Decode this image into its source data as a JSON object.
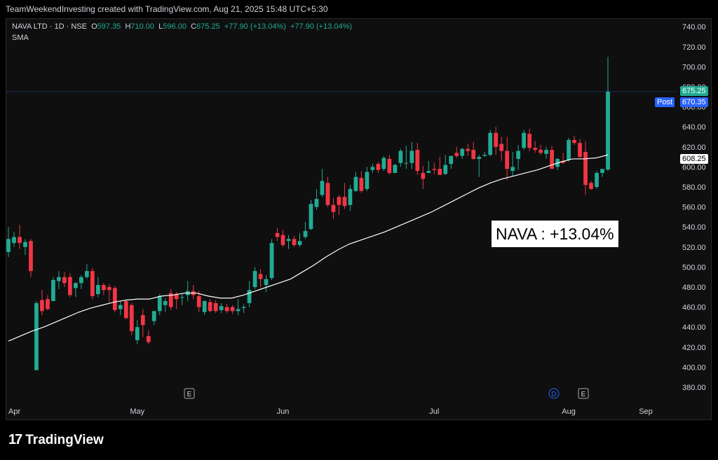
{
  "header": {
    "attribution": "TeamWeekendInvesting created with TradingView.com, Aug 21, 2025 15:48 UTC+5:30"
  },
  "legend": {
    "symbol": "NAVA LTD · 1D · NSE",
    "o_label": "O",
    "o_value": "597.35",
    "h_label": "H",
    "h_value": "710.00",
    "l_label": "L",
    "l_value": "596.00",
    "c_label": "C",
    "c_value": "675.25",
    "change1": "+77.90 (+13.04%)",
    "change2": "+77.90 (+13.04%)",
    "indicator": "SMA"
  },
  "annotation": "NAVA : +13.04%",
  "price_tags": {
    "last": "675.25",
    "post_label": "Post",
    "post": "670.35",
    "sma": "608.25"
  },
  "footer": {
    "brand": "TradingView",
    "logo_mark": "17"
  },
  "colors": {
    "up": "#22ab94",
    "down": "#f23645",
    "sma": "#ffffff",
    "post": "#2962ff",
    "background": "#0f0f0f"
  },
  "chart_data": {
    "type": "candlestick",
    "ylim": [
      370,
      745
    ],
    "yticks": [
      380,
      400,
      420,
      440,
      460,
      480,
      500,
      520,
      540,
      560,
      580,
      600,
      620,
      640,
      660,
      680,
      700,
      720,
      740
    ],
    "x_month_labels": [
      "Apr",
      "May",
      "Jun",
      "Jul",
      "Aug",
      "Sep"
    ],
    "event_markers": [
      "E",
      "D",
      "E"
    ],
    "ohlc": [
      {
        "o": 515,
        "h": 540,
        "l": 510,
        "c": 528
      },
      {
        "o": 524,
        "h": 535,
        "l": 520,
        "c": 530
      },
      {
        "o": 530,
        "h": 542,
        "l": 518,
        "c": 524
      },
      {
        "o": 520,
        "h": 528,
        "l": 512,
        "c": 525
      },
      {
        "o": 526,
        "h": 528,
        "l": 490,
        "c": 496
      },
      {
        "o": 397,
        "h": 466,
        "l": 397,
        "c": 464
      },
      {
        "o": 467,
        "h": 477,
        "l": 452,
        "c": 456
      },
      {
        "o": 468,
        "h": 472,
        "l": 457,
        "c": 458
      },
      {
        "o": 466,
        "h": 490,
        "l": 466,
        "c": 487
      },
      {
        "o": 486,
        "h": 496,
        "l": 478,
        "c": 490
      },
      {
        "o": 490,
        "h": 495,
        "l": 480,
        "c": 484
      },
      {
        "o": 490,
        "h": 494,
        "l": 470,
        "c": 472
      },
      {
        "o": 479,
        "h": 485,
        "l": 470,
        "c": 484
      },
      {
        "o": 484,
        "h": 492,
        "l": 478,
        "c": 490
      },
      {
        "o": 490,
        "h": 503,
        "l": 488,
        "c": 496
      },
      {
        "o": 496,
        "h": 499,
        "l": 468,
        "c": 471
      },
      {
        "o": 473,
        "h": 490,
        "l": 470,
        "c": 482
      },
      {
        "o": 482,
        "h": 484,
        "l": 472,
        "c": 477
      },
      {
        "o": 480,
        "h": 483,
        "l": 465,
        "c": 477
      },
      {
        "o": 479,
        "h": 481,
        "l": 455,
        "c": 457
      },
      {
        "o": 458,
        "h": 466,
        "l": 452,
        "c": 462
      },
      {
        "o": 466,
        "h": 467,
        "l": 448,
        "c": 449
      },
      {
        "o": 462,
        "h": 464,
        "l": 432,
        "c": 436
      },
      {
        "o": 427,
        "h": 447,
        "l": 423,
        "c": 440
      },
      {
        "o": 452,
        "h": 458,
        "l": 430,
        "c": 442
      },
      {
        "o": 431,
        "h": 437,
        "l": 423,
        "c": 425
      },
      {
        "o": 446,
        "h": 456,
        "l": 442,
        "c": 456
      },
      {
        "o": 456,
        "h": 473,
        "l": 452,
        "c": 471
      },
      {
        "o": 462,
        "h": 469,
        "l": 455,
        "c": 466
      },
      {
        "o": 474,
        "h": 478,
        "l": 457,
        "c": 460
      },
      {
        "o": 473,
        "h": 475,
        "l": 458,
        "c": 468
      },
      {
        "o": 470,
        "h": 474,
        "l": 462,
        "c": 470
      },
      {
        "o": 472,
        "h": 486,
        "l": 466,
        "c": 476
      },
      {
        "o": 476,
        "h": 482,
        "l": 468,
        "c": 472
      },
      {
        "o": 471,
        "h": 476,
        "l": 455,
        "c": 460
      },
      {
        "o": 455,
        "h": 467,
        "l": 452,
        "c": 466
      },
      {
        "o": 465,
        "h": 468,
        "l": 455,
        "c": 456
      },
      {
        "o": 464,
        "h": 467,
        "l": 454,
        "c": 456
      },
      {
        "o": 457,
        "h": 464,
        "l": 454,
        "c": 461
      },
      {
        "o": 460,
        "h": 463,
        "l": 454,
        "c": 456
      },
      {
        "o": 460,
        "h": 462,
        "l": 453,
        "c": 456
      },
      {
        "o": 456,
        "h": 468,
        "l": 452,
        "c": 458
      },
      {
        "o": 459,
        "h": 463,
        "l": 454,
        "c": 460
      },
      {
        "o": 464,
        "h": 486,
        "l": 460,
        "c": 477
      },
      {
        "o": 480,
        "h": 500,
        "l": 478,
        "c": 496
      },
      {
        "o": 493,
        "h": 498,
        "l": 480,
        "c": 488
      },
      {
        "o": 482,
        "h": 492,
        "l": 475,
        "c": 488
      },
      {
        "o": 489,
        "h": 528,
        "l": 487,
        "c": 524
      },
      {
        "o": 534,
        "h": 539,
        "l": 526,
        "c": 530
      },
      {
        "o": 532,
        "h": 537,
        "l": 520,
        "c": 522
      },
      {
        "o": 526,
        "h": 532,
        "l": 518,
        "c": 528
      },
      {
        "o": 528,
        "h": 531,
        "l": 520,
        "c": 522
      },
      {
        "o": 522,
        "h": 534,
        "l": 520,
        "c": 526
      },
      {
        "o": 530,
        "h": 545,
        "l": 528,
        "c": 536
      },
      {
        "o": 538,
        "h": 567,
        "l": 537,
        "c": 563
      },
      {
        "o": 560,
        "h": 578,
        "l": 557,
        "c": 568
      },
      {
        "o": 572,
        "h": 598,
        "l": 570,
        "c": 586
      },
      {
        "o": 584,
        "h": 590,
        "l": 560,
        "c": 562
      },
      {
        "o": 562,
        "h": 569,
        "l": 548,
        "c": 555
      },
      {
        "o": 570,
        "h": 572,
        "l": 552,
        "c": 562
      },
      {
        "o": 570,
        "h": 584,
        "l": 558,
        "c": 561
      },
      {
        "o": 562,
        "h": 582,
        "l": 556,
        "c": 578
      },
      {
        "o": 576,
        "h": 595,
        "l": 575,
        "c": 590
      },
      {
        "o": 589,
        "h": 596,
        "l": 574,
        "c": 576
      },
      {
        "o": 578,
        "h": 600,
        "l": 576,
        "c": 595
      },
      {
        "o": 597,
        "h": 603,
        "l": 594,
        "c": 600
      },
      {
        "o": 603,
        "h": 605,
        "l": 594,
        "c": 597
      },
      {
        "o": 598,
        "h": 611,
        "l": 596,
        "c": 609
      },
      {
        "o": 608,
        "h": 612,
        "l": 592,
        "c": 594
      },
      {
        "o": 594,
        "h": 603,
        "l": 594,
        "c": 602
      },
      {
        "o": 604,
        "h": 618,
        "l": 600,
        "c": 616
      },
      {
        "o": 604,
        "h": 621,
        "l": 598,
        "c": 604
      },
      {
        "o": 604,
        "h": 625,
        "l": 598,
        "c": 616
      },
      {
        "o": 617,
        "h": 624,
        "l": 592,
        "c": 596
      },
      {
        "o": 594,
        "h": 601,
        "l": 578,
        "c": 588
      },
      {
        "o": 594,
        "h": 606,
        "l": 594,
        "c": 596
      },
      {
        "o": 598,
        "h": 604,
        "l": 593,
        "c": 597
      },
      {
        "o": 598,
        "h": 610,
        "l": 592,
        "c": 592
      },
      {
        "o": 593,
        "h": 612,
        "l": 592,
        "c": 602
      },
      {
        "o": 603,
        "h": 611,
        "l": 598,
        "c": 611
      },
      {
        "o": 614,
        "h": 620,
        "l": 609,
        "c": 611
      },
      {
        "o": 611,
        "h": 619,
        "l": 608,
        "c": 618
      },
      {
        "o": 618,
        "h": 623,
        "l": 611,
        "c": 616
      },
      {
        "o": 617,
        "h": 625,
        "l": 607,
        "c": 608
      },
      {
        "o": 608,
        "h": 612,
        "l": 590,
        "c": 610
      },
      {
        "o": 611,
        "h": 615,
        "l": 610,
        "c": 612
      },
      {
        "o": 612,
        "h": 637,
        "l": 611,
        "c": 634
      },
      {
        "o": 634,
        "h": 640,
        "l": 612,
        "c": 620
      },
      {
        "o": 623,
        "h": 630,
        "l": 606,
        "c": 616
      },
      {
        "o": 616,
        "h": 630,
        "l": 587,
        "c": 598
      },
      {
        "o": 596,
        "h": 615,
        "l": 591,
        "c": 600
      },
      {
        "o": 608,
        "h": 622,
        "l": 597,
        "c": 616
      },
      {
        "o": 619,
        "h": 637,
        "l": 617,
        "c": 634
      },
      {
        "o": 633,
        "h": 638,
        "l": 616,
        "c": 619
      },
      {
        "o": 619,
        "h": 626,
        "l": 614,
        "c": 617
      },
      {
        "o": 617,
        "h": 622,
        "l": 612,
        "c": 614
      },
      {
        "o": 613,
        "h": 620,
        "l": 608,
        "c": 617
      },
      {
        "o": 617,
        "h": 621,
        "l": 600,
        "c": 598
      },
      {
        "o": 600,
        "h": 609,
        "l": 597,
        "c": 608
      },
      {
        "o": 606,
        "h": 614,
        "l": 603,
        "c": 604
      },
      {
        "o": 607,
        "h": 629,
        "l": 605,
        "c": 627
      },
      {
        "o": 627,
        "h": 631,
        "l": 622,
        "c": 624
      },
      {
        "o": 624,
        "h": 628,
        "l": 608,
        "c": 610
      },
      {
        "o": 615,
        "h": 626,
        "l": 572,
        "c": 582
      },
      {
        "o": 584,
        "h": 586,
        "l": 577,
        "c": 578
      },
      {
        "o": 580,
        "h": 596,
        "l": 578,
        "c": 594
      },
      {
        "o": 594,
        "h": 598,
        "l": 590,
        "c": 598
      },
      {
        "o": 597.35,
        "h": 710,
        "l": 596,
        "c": 675.25
      }
    ],
    "sma": [
      [
        0,
        426
      ],
      [
        10,
        431
      ],
      [
        20,
        436
      ],
      [
        30,
        440
      ],
      [
        40,
        445
      ],
      [
        50,
        450
      ],
      [
        60,
        455
      ],
      [
        70,
        459
      ],
      [
        80,
        462
      ],
      [
        90,
        465
      ],
      [
        100,
        467
      ],
      [
        110,
        468
      ],
      [
        120,
        468
      ],
      [
        130,
        471
      ],
      [
        140,
        472
      ],
      [
        150,
        474
      ],
      [
        160,
        474
      ],
      [
        170,
        471
      ],
      [
        180,
        469
      ],
      [
        190,
        469
      ],
      [
        200,
        472
      ],
      [
        210,
        476
      ],
      [
        220,
        480
      ],
      [
        230,
        484
      ],
      [
        240,
        488
      ],
      [
        250,
        495
      ],
      [
        260,
        502
      ],
      [
        270,
        510
      ],
      [
        280,
        517
      ],
      [
        290,
        523
      ],
      [
        300,
        527
      ],
      [
        310,
        531
      ],
      [
        320,
        535
      ],
      [
        330,
        540
      ],
      [
        340,
        545
      ],
      [
        350,
        550
      ],
      [
        360,
        555
      ],
      [
        370,
        561
      ],
      [
        380,
        567
      ],
      [
        390,
        573
      ],
      [
        400,
        579
      ],
      [
        410,
        584
      ],
      [
        420,
        588
      ],
      [
        430,
        591
      ],
      [
        440,
        594
      ],
      [
        450,
        597
      ],
      [
        460,
        601
      ],
      [
        470,
        605
      ],
      [
        480,
        608
      ],
      [
        490,
        608
      ],
      [
        500,
        609
      ],
      [
        510,
        612
      ]
    ],
    "sma_x_scale_max": 510
  }
}
